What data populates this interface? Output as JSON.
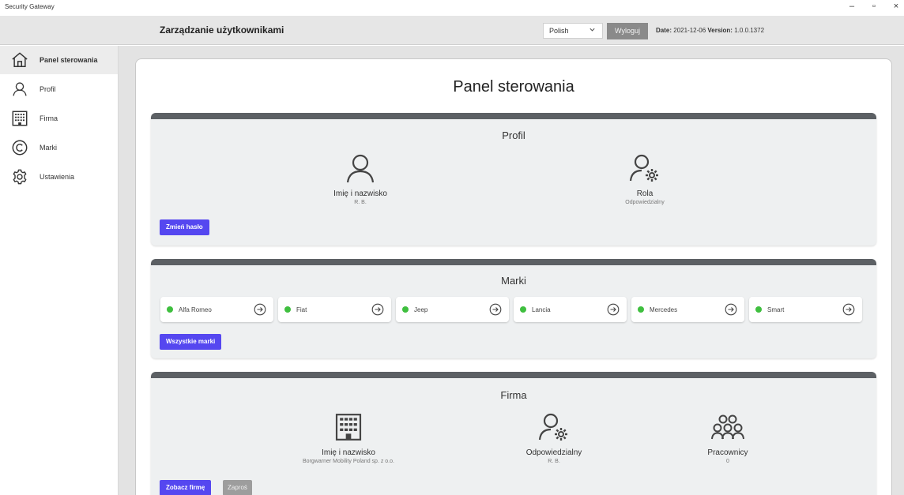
{
  "window": {
    "title": "Security Gateway",
    "minimize": "–",
    "maximize": "▫",
    "close": "×"
  },
  "header": {
    "title": "Zarządzanie użytkownikami",
    "language": "Polish",
    "logout": "Wyloguj",
    "date_label": "Date:",
    "date_value": "2021-12-06",
    "version_label": "Version:",
    "version_value": "1.0.0.1372"
  },
  "sidebar": {
    "items": [
      {
        "label": "Panel sterowania",
        "icon": "home-icon",
        "active": true
      },
      {
        "label": "Profil",
        "icon": "user-icon",
        "active": false
      },
      {
        "label": "Firma",
        "icon": "building-icon",
        "active": false
      },
      {
        "label": "Marki",
        "icon": "copyright-icon",
        "active": false
      },
      {
        "label": "Ustawienia",
        "icon": "gear-icon",
        "active": false
      }
    ]
  },
  "main": {
    "title": "Panel sterowania",
    "profile": {
      "title": "Profil",
      "name_label": "Imię i nazwisko",
      "name_value": "R.     B.",
      "role_label": "Rola",
      "role_value": "Odpowiedzialny",
      "change_password": "Zmień hasło"
    },
    "brands": {
      "title": "Marki",
      "items": [
        "Alfa Romeo",
        "Fiat",
        "Jeep",
        "Lancia",
        "Mercedes",
        "Smart"
      ],
      "all_brands": "Wszystkie marki",
      "status_color": "#3fbf3f"
    },
    "company": {
      "title": "Firma",
      "name_label": "Imię i nazwisko",
      "name_value": "Borgwarner Mobility Poland sp. z o.o.",
      "responsible_label": "Odpowiedzialny",
      "responsible_value": "R.     B.",
      "employees_label": "Pracownicy",
      "employees_value": "0",
      "view_company": "Zobacz firmę",
      "invite": "Zaproś"
    }
  },
  "colors": {
    "accent": "#5547f0",
    "card_header": "#5c6064",
    "status_active": "#3fbf3f"
  }
}
